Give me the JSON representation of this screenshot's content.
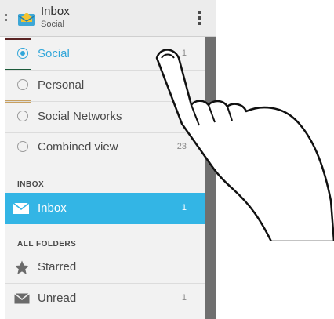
{
  "header": {
    "title": "Inbox",
    "subtitle": "Social"
  },
  "accounts": [
    {
      "label": "Social",
      "count": "1",
      "selected": true,
      "color": "#5a2424"
    },
    {
      "label": "Personal",
      "count": "",
      "selected": false,
      "color": "#1c5a3a"
    },
    {
      "label": "Social Networks",
      "count": "",
      "selected": false,
      "color": "#c8a060"
    },
    {
      "label": "Combined view",
      "count": "23",
      "selected": false,
      "color": ""
    }
  ],
  "inbox_section": {
    "heading": "INBOX",
    "item": {
      "label": "Inbox",
      "count": "1",
      "icon": "envelope-icon"
    }
  },
  "folders_section": {
    "heading": "ALL FOLDERS",
    "items": [
      {
        "label": "Starred",
        "count": "",
        "icon": "star-icon"
      },
      {
        "label": "Unread",
        "count": "1",
        "icon": "unread-envelope-icon"
      }
    ]
  },
  "colors": {
    "accent": "#33b5e5",
    "selected_radio": "#31a6d9"
  }
}
